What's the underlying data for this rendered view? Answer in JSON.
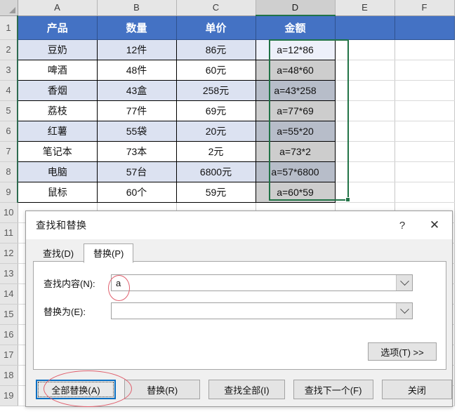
{
  "spreadsheet": {
    "corner_icon": "select-all-triangle-icon",
    "columns": [
      "A",
      "B",
      "C",
      "D",
      "E",
      "F"
    ],
    "selected_column": "D",
    "rows_visible": [
      "1",
      "2",
      "3",
      "4",
      "5",
      "6",
      "7",
      "8",
      "9",
      "10",
      "11",
      "12",
      "13",
      "14",
      "15",
      "16",
      "17",
      "18",
      "19"
    ],
    "header_row": {
      "a": "产品",
      "b": "数量",
      "c": "单价",
      "d": "金额"
    },
    "data_rows": [
      {
        "row": "2",
        "a": "豆奶",
        "b": "12件",
        "c": "86元",
        "d": "a=12*86"
      },
      {
        "row": "3",
        "a": "啤酒",
        "b": "48件",
        "c": "60元",
        "d": "a=48*60"
      },
      {
        "row": "4",
        "a": "香烟",
        "b": "43盒",
        "c": "258元",
        "d": "a=43*258"
      },
      {
        "row": "5",
        "a": "荔枝",
        "b": "77件",
        "c": "69元",
        "d": "a=77*69"
      },
      {
        "row": "6",
        "a": "红薯",
        "b": "55袋",
        "c": "20元",
        "d": "a=55*20"
      },
      {
        "row": "7",
        "a": "笔记本",
        "b": "73本",
        "c": "2元",
        "d": "a=73*2"
      },
      {
        "row": "8",
        "a": "电脑",
        "b": "57台",
        "c": "6800元",
        "d": "a=57*6800"
      },
      {
        "row": "9",
        "a": "鼠标",
        "b": "60个",
        "c": "59元",
        "d": "a=60*59"
      }
    ],
    "selection_range": "D2:D9",
    "colors": {
      "header_fill": "#4472c4",
      "header_text": "#ffffff",
      "band_fill": "#dce2f1",
      "selection_border": "#217346",
      "selection_fill": "#cdcdcd"
    }
  },
  "dialog": {
    "title": "查找和替换",
    "help_label": "?",
    "close_label": "✕",
    "tabs": [
      {
        "label": "查找(D)",
        "active": false
      },
      {
        "label": "替换(P)",
        "active": true
      }
    ],
    "fields": {
      "find_label": "查找内容(N):",
      "find_value": "a",
      "replace_label": "替换为(E):",
      "replace_value": ""
    },
    "options_button": "选项(T) >>",
    "buttons": [
      {
        "label": "全部替换(A)",
        "focused": true
      },
      {
        "label": "替换(R)",
        "focused": false
      },
      {
        "label": "查找全部(I)",
        "focused": false
      },
      {
        "label": "查找下一个(F)",
        "focused": false
      },
      {
        "label": "关闭",
        "focused": false
      }
    ]
  },
  "annotations": {
    "highlight_color": "#e0606e",
    "focus_color": "#0a6fc2",
    "items": [
      {
        "target": "find-content-input",
        "shape": "ellipse"
      },
      {
        "target": "replace-all-button",
        "shape": "ellipse"
      }
    ]
  }
}
